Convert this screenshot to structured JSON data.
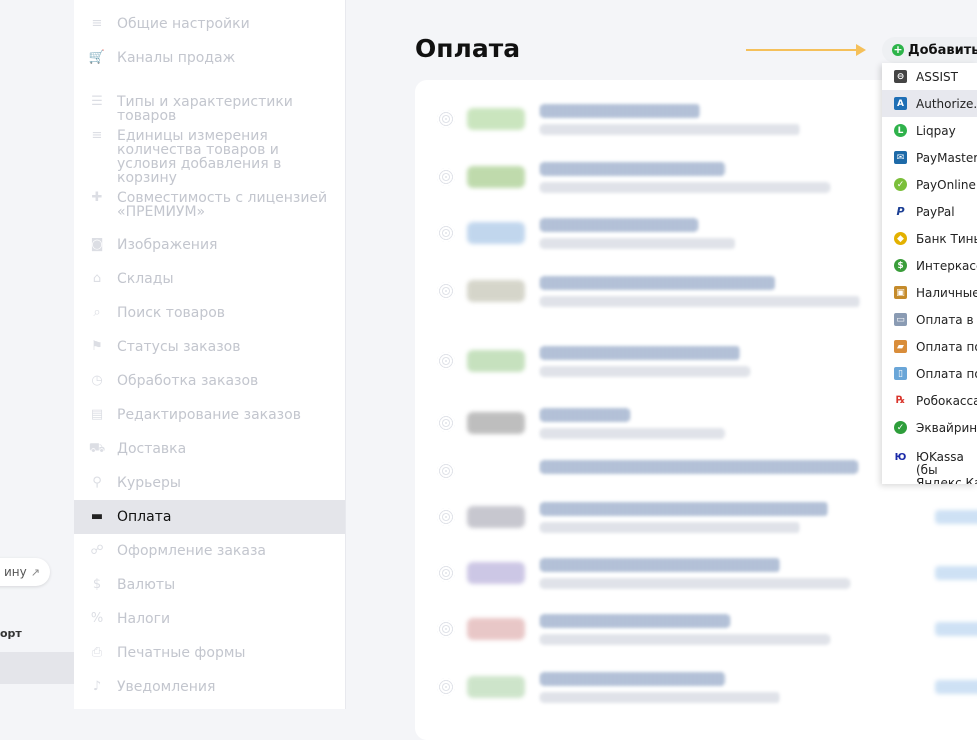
{
  "left_panel": {
    "store_link_label": "ину",
    "section_label": "орт"
  },
  "sidebar": {
    "items": [
      {
        "label": "Общие настройки",
        "icon": "list-icon"
      },
      {
        "label": "Каналы продаж",
        "icon": "cart-icon"
      },
      {
        "label": "Типы и характеристики товаров",
        "icon": "list-bullets-icon"
      },
      {
        "label": "Единицы измерения количества товаров и условия добавления в корзину",
        "icon": "list-icon"
      },
      {
        "label": "Совместимость с лицензией «ПРЕМИУМ»",
        "icon": "puzzle-icon"
      },
      {
        "label": "Изображения",
        "icon": "camera-icon"
      },
      {
        "label": "Склады",
        "icon": "home-icon"
      },
      {
        "label": "Поиск товаров",
        "icon": "search-icon"
      },
      {
        "label": "Статусы заказов",
        "icon": "flag-icon"
      },
      {
        "label": "Обработка заказов",
        "icon": "clock-icon"
      },
      {
        "label": "Редактирование заказов",
        "icon": "table-icon"
      },
      {
        "label": "Доставка",
        "icon": "truck-icon"
      },
      {
        "label": "Курьеры",
        "icon": "walker-icon"
      },
      {
        "label": "Оплата",
        "icon": "card-icon"
      },
      {
        "label": "Оформление заказа",
        "icon": "checkout-icon"
      },
      {
        "label": "Валюты",
        "icon": "dollar-icon"
      },
      {
        "label": "Налоги",
        "icon": "percent-icon"
      },
      {
        "label": "Печатные формы",
        "icon": "printer-icon"
      },
      {
        "label": "Уведомления",
        "icon": "bell-icon"
      }
    ],
    "active_index": 13
  },
  "main": {
    "title": "Оплата",
    "add_button_label": "Добавить с"
  },
  "dropdown": {
    "items": [
      {
        "label": "ASSIST",
        "icon": "assist-icon",
        "color": "#444444"
      },
      {
        "label": "Authorize.N",
        "icon": "authorize-net-icon",
        "color": "#1f6fb5"
      },
      {
        "label": "Liqpay",
        "icon": "liqpay-icon",
        "color": "#2fb24b"
      },
      {
        "label": "PayMaster",
        "icon": "paymaster-icon",
        "color": "#1e6aa8"
      },
      {
        "label": "PayOnline",
        "icon": "payonline-icon",
        "color": "#7bbf3a"
      },
      {
        "label": "PayPal",
        "icon": "paypal-icon",
        "color": "#1c3f94"
      },
      {
        "label": "Банк Тиньк",
        "icon": "tinkoff-icon",
        "color": "#e3b100"
      },
      {
        "label": "Интеркасса",
        "icon": "interkassa-icon",
        "color": "#3a9d3a"
      },
      {
        "label": "Наличные",
        "icon": "cash-icon",
        "color": "#c58b2b"
      },
      {
        "label": "Оплата в р",
        "icon": "invoice-icon",
        "color": "#8a9bb3"
      },
      {
        "label": "Оплата по",
        "icon": "bank-transfer-icon",
        "color": "#d98d3a"
      },
      {
        "label": "Оплата по",
        "icon": "document-icon",
        "color": "#6aa6d8"
      },
      {
        "label": "Робокасса",
        "icon": "robokassa-icon",
        "color": "#d9342b"
      },
      {
        "label": "Эквайринг",
        "icon": "acquiring-icon",
        "color": "#2e9e3b"
      },
      {
        "label": "ЮKassa (бы Яндекс.Кас",
        "icon": "yookassa-icon",
        "color": "#1b2aa8"
      }
    ],
    "highlighted_index": 1
  },
  "colors": {
    "accent_green": "#2db44a",
    "arrow": "#f5c05a",
    "active_bg": "#e4e5ea"
  }
}
